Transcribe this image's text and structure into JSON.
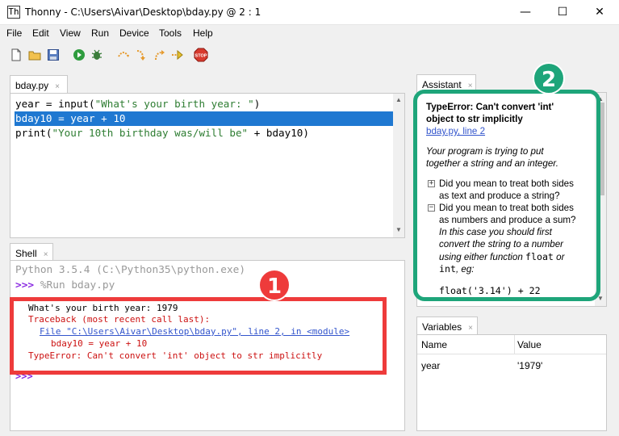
{
  "window": {
    "app_icon": "Th",
    "title": "Thonny  -  C:\\Users\\Aivar\\Desktop\\bday.py  @  2 : 1",
    "minimize_glyph": "—",
    "maximize_glyph": "☐",
    "close_glyph": "✕"
  },
  "menu": [
    "File",
    "Edit",
    "View",
    "Run",
    "Device",
    "Tools",
    "Help"
  ],
  "toolbar": {
    "icons": [
      "new-file-icon",
      "open-file-icon",
      "save-icon",
      "run-icon",
      "debug-icon",
      "step-over-icon",
      "step-into-icon",
      "step-out-icon",
      "resume-icon",
      "stop-icon"
    ],
    "stop_label": "STOP"
  },
  "editor": {
    "tab_label": "bday.py",
    "tab_close": "×",
    "lines": [
      {
        "pre": "year = input(",
        "str": "\"What's your birth year: \"",
        "post": ")"
      },
      {
        "text": "bday10 = year + 10"
      },
      {
        "pre": "print(",
        "str": "\"Your 10th birthday was/will be\"",
        "post": " + bday10)"
      }
    ]
  },
  "shell": {
    "tab_label": "Shell",
    "tab_close": "×",
    "python_version": "Python 3.5.4 (C:\\Python35\\python.exe)",
    "prompt": ">>>",
    "run_command": " %Run bday.py",
    "input_prompt": "What's your birth year: ",
    "input_value": "1979",
    "traceback_header": "Traceback (most recent call last):",
    "traceback_file": "File \"C:\\Users\\Aivar\\Desktop\\bday.py\", line 2, in <module>",
    "traceback_code": "bday10 = year + 10",
    "error_message": "TypeError: Can't convert 'int' object to str implicitly",
    "trailing_prompt": ">>>"
  },
  "assistant": {
    "tab_label": "Assistant",
    "tab_close": "×",
    "error_title_line1": "TypeError: Can't convert 'int'",
    "error_title_line2": "object to str implicitly",
    "location_link": "bday.py, line 2",
    "explanation_line1": "Your program is trying to put",
    "explanation_line2": "together a string and an integer.",
    "option1_toggle": "+",
    "option1_line1": "Did you mean to treat both sides",
    "option1_line2": "as text and produce a string?",
    "option2_toggle": "−",
    "option2_line1": "Did you mean to treat both sides",
    "option2_line2": "as numbers and produce a sum?",
    "detail_line1": "In this case you should first",
    "detail_line2": "convert the string to a number",
    "detail_line3_pre": "using either function ",
    "detail_line3_code": "float",
    "detail_line3_post": " or",
    "detail_line4_code": "int",
    "detail_line4_post": ", eg:",
    "example_code": "float('3.14') + 22"
  },
  "variables": {
    "tab_label": "Variables",
    "tab_close": "×",
    "headers": [
      "Name",
      "Value"
    ],
    "rows": [
      {
        "name": "year",
        "value": "'1979'"
      }
    ]
  },
  "annotations": {
    "badge1": "1",
    "badge2": "2",
    "red": "#ee3b3b",
    "green": "#1ea57a"
  }
}
